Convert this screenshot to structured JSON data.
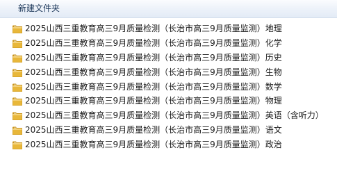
{
  "toolbar": {
    "new_folder_label": "新建文件夹"
  },
  "folders": [
    {
      "name": "2025山西三重教育高三9月质量检测（长治市高三9月质量监测）地理"
    },
    {
      "name": "2025山西三重教育高三9月质量检测（长治市高三9月质量监测）化学"
    },
    {
      "name": "2025山西三重教育高三9月质量检测（长治市高三9月质量监测）历史"
    },
    {
      "name": "2025山西三重教育高三9月质量检测（长治市高三9月质量监测）生物"
    },
    {
      "name": "2025山西三重教育高三9月质量检测（长治市高三9月质量监测）数学"
    },
    {
      "name": "2025山西三重教育高三9月质量检测（长治市高三9月质量监测）物理"
    },
    {
      "name": "2025山西三重教育高三9月质量检测（长治市高三9月质量监测）英语（含听力）"
    },
    {
      "name": "2025山西三重教育高三9月质量检测（长治市高三9月质量监测）语文"
    },
    {
      "name": "2025山西三重教育高三9月质量检测（长治市高三9月质量监测）政治"
    }
  ],
  "icons": {
    "folder": "folder-icon"
  },
  "colors": {
    "folder_body": "#e8b73a",
    "folder_dark": "#c9951f",
    "toolbar_text": "#1e395b"
  }
}
